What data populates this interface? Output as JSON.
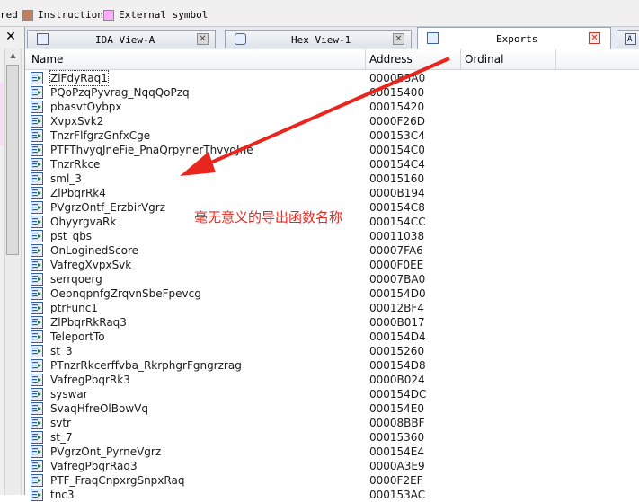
{
  "legend": [
    {
      "label": "red",
      "swatch": null
    },
    {
      "label": "Instruction",
      "swatch": "#c08060"
    },
    {
      "label": "External symbol",
      "swatch": "#ffaaff"
    }
  ],
  "left_pane": {
    "close_glyph": "✕",
    "scroll_up_glyph": "▲"
  },
  "tabs": [
    {
      "label": "IDA View-A",
      "icon": "ida-view-icon",
      "close_glyph": "✕"
    },
    {
      "label": "Hex View-1",
      "icon": "hex-view-icon",
      "close_glyph": "✕"
    },
    {
      "label": "Exports",
      "icon": "exports-icon",
      "close_glyph": "✕",
      "active": true
    },
    {
      "label": "A",
      "icon": "structures-icon"
    }
  ],
  "table": {
    "columns": [
      "Name",
      "Address",
      "Ordinal"
    ],
    "rows": [
      {
        "name": "ZlFdyRaq1",
        "address": "0000B3A0"
      },
      {
        "name": "PQoPzqPyvrag_NqqQoPzq",
        "address": "00015400"
      },
      {
        "name": "pbasvtOybpx",
        "address": "00015420"
      },
      {
        "name": "XvpxSvk2",
        "address": "0000F26D"
      },
      {
        "name": "TnzrFlfgrzGnfxCge",
        "address": "000153C4"
      },
      {
        "name": "PTFThvyqJneFie_PnaQrpynerThvyqJne",
        "address": "000154C0"
      },
      {
        "name": "TnzrRkce",
        "address": "000154C4"
      },
      {
        "name": "sml_3",
        "address": "00015160"
      },
      {
        "name": "ZlPbqrRk4",
        "address": "0000B194"
      },
      {
        "name": "PVgrzOntf_ErzbirVgrz",
        "address": "000154C8"
      },
      {
        "name": "OhyyrgvaRk",
        "address": "000154CC"
      },
      {
        "name": "pst_qbs",
        "address": "00011038"
      },
      {
        "name": "OnLoginedScore",
        "address": "00007FA6"
      },
      {
        "name": "VafregXvpxSvk",
        "address": "0000F0EE"
      },
      {
        "name": "serrqoerg",
        "address": "00007BA0"
      },
      {
        "name": "OebnqpnfgZrqvnSbeFpevcg",
        "address": "000154D0"
      },
      {
        "name": "ptrFunc1",
        "address": "00012BF4"
      },
      {
        "name": "ZlPbqrRkRaq3",
        "address": "0000B017"
      },
      {
        "name": "TeleportTo",
        "address": "000154D4"
      },
      {
        "name": "st_3",
        "address": "00015260"
      },
      {
        "name": "PTnzrRkcerffvba_RkrphgrFgngrzrag",
        "address": "000154D8"
      },
      {
        "name": "VafregPbqrRk3",
        "address": "0000B024"
      },
      {
        "name": "syswar",
        "address": "000154DC"
      },
      {
        "name": "SvaqHfreOlBowVq",
        "address": "000154E0"
      },
      {
        "name": "svtr",
        "address": "00008BBF"
      },
      {
        "name": "st_7",
        "address": "00015360"
      },
      {
        "name": "PVgrzOnt_PyrneVgrz",
        "address": "000154E4"
      },
      {
        "name": "VafregPbqrRaq3",
        "address": "0000A3E9"
      },
      {
        "name": "PTF_FraqCnpxrgSnpxRaq",
        "address": "0000F2EF"
      },
      {
        "name": "tnc3",
        "address": "000153AC"
      }
    ]
  },
  "annotation": {
    "text": "毫无意义的导出函数名称",
    "color": "#e8261e"
  }
}
